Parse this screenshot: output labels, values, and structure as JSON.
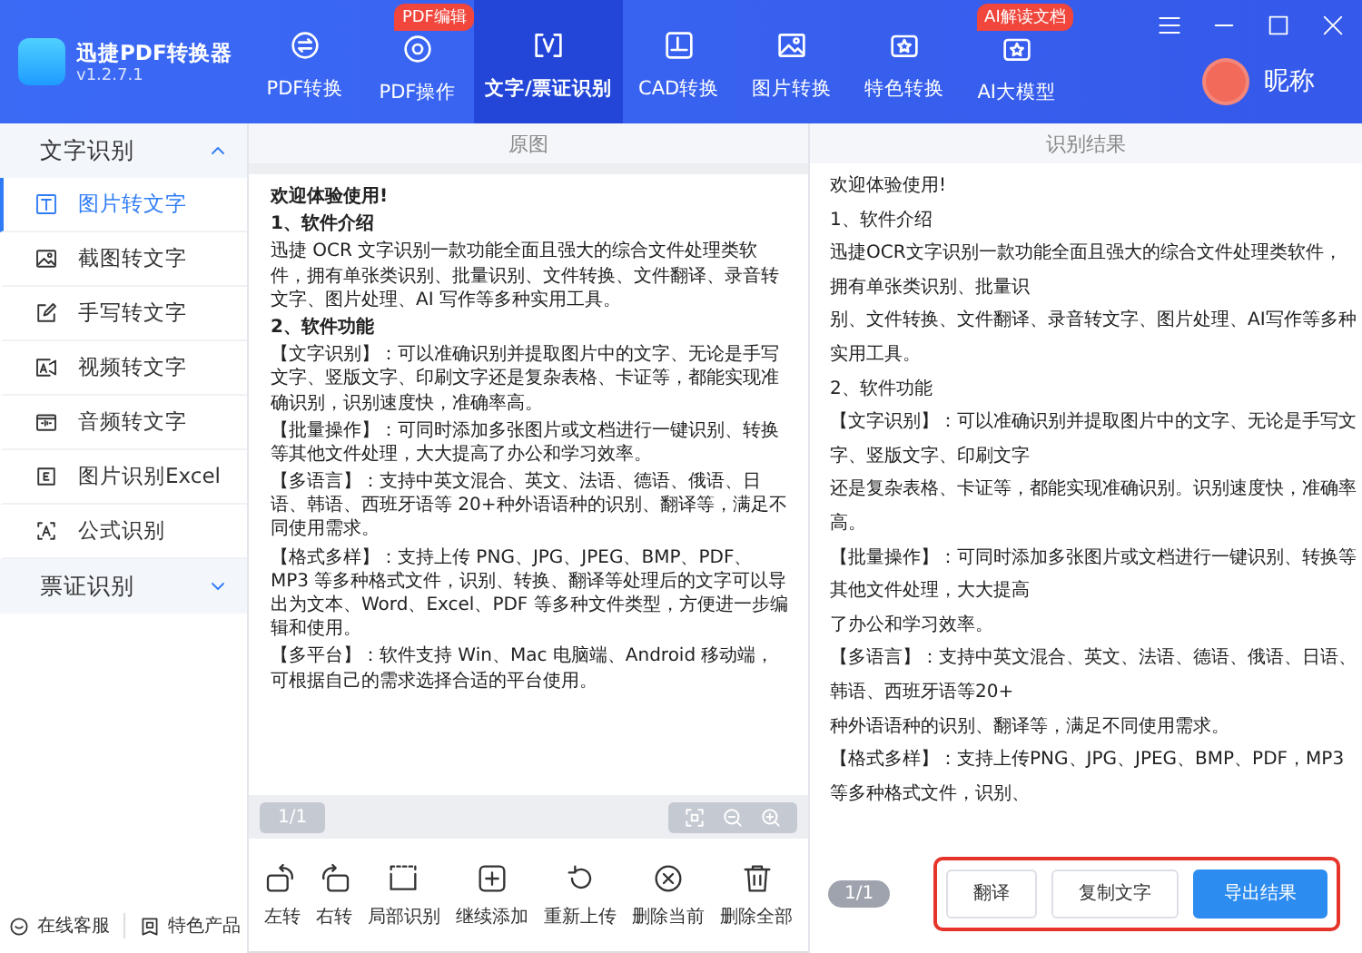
{
  "app": {
    "name": "迅捷PDF转换器",
    "version": "v1.2.7.1"
  },
  "nav_tabs": [
    {
      "label": "PDF转换",
      "selected": false
    },
    {
      "label": "PDF操作",
      "badge": "PDF编辑",
      "selected": false
    },
    {
      "label": "文字/票证识别",
      "selected": true
    },
    {
      "label": "CAD转换",
      "selected": false
    },
    {
      "label": "图片转换",
      "selected": false
    },
    {
      "label": "特色转换",
      "selected": false
    },
    {
      "label": "AI大模型",
      "badge": "AI解读文档",
      "selected": false
    }
  ],
  "user": {
    "name": "昵称"
  },
  "sidebar": {
    "groups": [
      {
        "label": "文字识别",
        "expanded": true,
        "items": [
          {
            "label": "图片转文字",
            "selected": true
          },
          {
            "label": "截图转文字",
            "selected": false
          },
          {
            "label": "手写转文字",
            "selected": false
          },
          {
            "label": "视频转文字",
            "selected": false
          },
          {
            "label": "音频转文字",
            "selected": false
          },
          {
            "label": "图片识别Excel",
            "selected": false
          },
          {
            "label": "公式识别",
            "selected": false
          }
        ]
      },
      {
        "label": "票证识别",
        "expanded": false
      }
    ],
    "footer": [
      "在线客服",
      "特色产品"
    ]
  },
  "original_panel": {
    "title": "原图",
    "document": [
      {
        "kind": "heading",
        "text": "欢迎体验使用!"
      },
      {
        "kind": "heading",
        "text": "1、软件介绍"
      },
      {
        "kind": "body",
        "text": "迅捷 OCR 文字识别一款功能全面且强大的综合文件处理类软件，拥有单张类识别、批量识别、文件转换、文件翻译、录音转文字、图片处理、AI 写作等多种实用工具。"
      },
      {
        "kind": "heading",
        "text": "2、软件功能"
      },
      {
        "kind": "body",
        "text": "【文字识别】：可以准确识别并提取图片中的文字、无论是手写文字、竖版文字、印刷文字还是复杂表格、卡证等，都能实现准确识别，识别速度快，准确率高。"
      },
      {
        "kind": "body",
        "text": "【批量操作】：可同时添加多张图片或文档进行一键识别、转换等其他文件处理，大大提高了办公和学习效率。"
      },
      {
        "kind": "body",
        "text": "【多语言】：支持中英文混合、英文、法语、德语、俄语、日语、韩语、西班牙语等 20+种外语语种的识别、翻译等，满足不同使用需求。"
      },
      {
        "kind": "body",
        "text": "【格式多样】：支持上传 PNG、JPG、JPEG、BMP、PDF、MP3 等多种格式文件，识别、转换、翻译等处理后的文字可以导出为文本、Word、Excel、PDF 等多种文件类型，方便进一步编辑和使用。"
      },
      {
        "kind": "body",
        "text": "【多平台】：软件支持 Win、Mac 电脑端、Android 移动端，可根据自己的需求选择合适的平台使用。"
      }
    ],
    "pager": "1/1",
    "toolbar": [
      "左转",
      "右转",
      "局部识别",
      "继续添加",
      "重新上传",
      "删除当前",
      "删除全部"
    ]
  },
  "result_panel": {
    "title": "识别结果",
    "lines": [
      "欢迎体验使用!",
      "1、软件介绍",
      "迅捷OCR文字识别一款功能全面且强大的综合文件处理类软件，",
      "拥有单张类识别、批量识",
      "别、文件转换、文件翻译、录音转文字、图片处理、AI写作等多种",
      "实用工具。",
      "2、软件功能",
      "【文字识别】：可以准确识别并提取图片中的文字、无论是手写文",
      "字、竖版文字、印刷文字",
      "还是复杂表格、卡证等，都能实现准确识别。识别速度快，准确率",
      "高。",
      "【批量操作】：可同时添加多张图片或文档进行一键识别、转换等",
      "其他文件处理，大大提高",
      "了办公和学习效率。",
      "【多语言】：支持中英文混合、英文、法语、德语、俄语、日语、",
      "韩语、西班牙语等20+",
      "种外语语种的识别、翻译等，满足不同使用需求。",
      "【格式多样】：支持上传PNG、JPG、JPEG、BMP、PDF，MP3",
      "等多种格式文件，识别、"
    ],
    "pager": "1/1",
    "buttons": [
      {
        "label": "翻译",
        "kind": "secondary"
      },
      {
        "label": "复制文字",
        "kind": "secondary"
      },
      {
        "label": "导出结果",
        "kind": "primary"
      }
    ],
    "highlighted": true
  }
}
